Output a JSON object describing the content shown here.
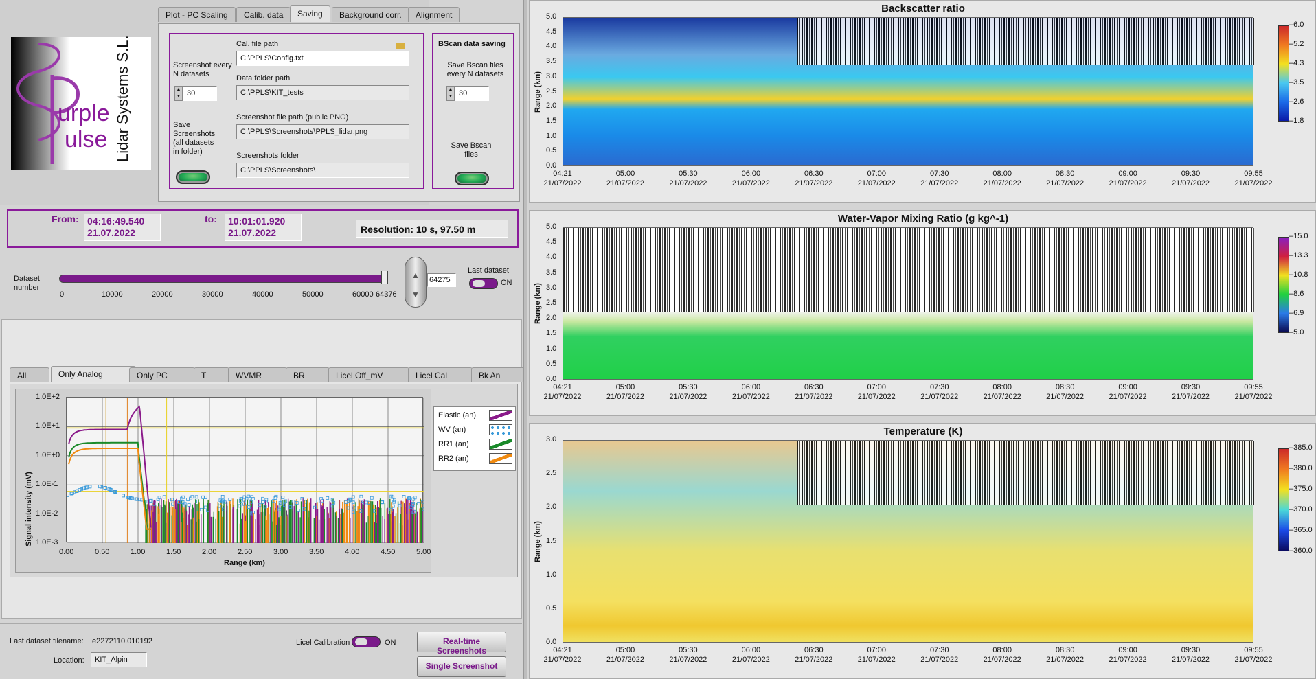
{
  "tabs_top": [
    "Plot - PC Scaling",
    "Calib. data",
    "Saving",
    "Background corr.",
    "Alignment"
  ],
  "logo": {
    "company": "Lidar Systems S.L.",
    "brand_line1": "urple",
    "brand_line2": "ulse"
  },
  "saving": {
    "screenshot_every_label": "Screenshot every N datasets",
    "screenshot_every_value": "30",
    "save_screenshots_label": "Save Screenshots (all datasets in folder)",
    "cal_file_label": "Cal. file path",
    "cal_file_value": "C:\\PPLS\\Config.txt",
    "data_folder_label": "Data folder path",
    "data_folder_value": "C:\\PPLS\\KIT_tests",
    "screenshot_path_label": "Screenshot file path (public PNG)",
    "screenshot_path_value": "C:\\PPLS\\Screenshots\\PPLS_lidar.png",
    "screenshots_folder_label": "Screenshots folder",
    "screenshots_folder_value": "C:\\PPLS\\Screenshots\\",
    "bscan_title": "BScan data saving",
    "bscan_every_label": "Save Bscan files every N datasets",
    "bscan_every_value": "30",
    "save_bscan_label": "Save Bscan files"
  },
  "range": {
    "from_label": "From:",
    "from_time": "04:16:49.540",
    "from_date": "21.07.2022",
    "to_label": "to:",
    "to_time": "10:01:01.920",
    "to_date": "21.07.2022",
    "resolution": "Resolution: 10 s, 97.50 m"
  },
  "dataset": {
    "label": "Dataset number",
    "value": "64275",
    "fraction": 0.9983,
    "ticks": [
      "0",
      "10000",
      "20000",
      "30000",
      "40000",
      "50000",
      "60000",
      "64376"
    ],
    "last_label": "Last dataset",
    "last_state": "ON"
  },
  "tabs_bottom": [
    "All",
    "Only Analog",
    "Only PC",
    "T",
    "WVMR",
    "BR",
    "Licel Off_mV",
    "Licel Cal",
    "Bk An"
  ],
  "signal_plot": {
    "ylabel": "Signal intensity (mV)",
    "xlabel": "Range (km)",
    "yticks": [
      "1.0E+2",
      "1.0E+1",
      "1.0E+0",
      "1.0E-1",
      "1.0E-2",
      "1.0E-3"
    ],
    "xticks": [
      "0.00",
      "0.50",
      "1.00",
      "1.50",
      "2.00",
      "2.50",
      "3.00",
      "3.50",
      "4.00",
      "4.50",
      "5.00"
    ],
    "legend": [
      {
        "name": "Elastic (an)",
        "color": "#8a1a8a"
      },
      {
        "name": "WV (an)",
        "color": "#3a9ad9"
      },
      {
        "name": "RR1 (an)",
        "color": "#1a8a2a"
      },
      {
        "name": "RR2 (an)",
        "color": "#f08a10"
      }
    ]
  },
  "footer": {
    "last_file_label": "Last dataset filename:",
    "last_file_value": "e2272110.010192",
    "location_label": "Location:",
    "location_value": "KIT_Alpin",
    "licel_cal_label": "Licel Calibration",
    "licel_cal_state": "ON",
    "btn_realtime": "Real-time Screenshots",
    "btn_single": "Single Screenshot"
  },
  "plots": [
    {
      "title": "Backscatter ratio",
      "ylabel": "Range (km)",
      "yticks": [
        "5.0",
        "4.5",
        "4.0",
        "3.5",
        "3.0",
        "2.5",
        "2.0",
        "1.5",
        "1.0",
        "0.5",
        "0.0"
      ],
      "cbar": [
        "6.0",
        "5.2",
        "4.3",
        "3.5",
        "2.6",
        "1.8"
      ]
    },
    {
      "title": "Water-Vapor Mixing Ratio  (g kg^-1)",
      "ylabel": "Range (km)",
      "yticks": [
        "5.0",
        "4.5",
        "4.0",
        "3.5",
        "3.0",
        "2.5",
        "2.0",
        "1.5",
        "1.0",
        "0.5",
        "0.0"
      ],
      "cbar": [
        "15.0",
        "13.3",
        "10.8",
        "8.6",
        "6.9",
        "5.0"
      ]
    },
    {
      "title": "Temperature (K)",
      "ylabel": "Range (km)",
      "yticks": [
        "3.0",
        "2.5",
        "2.0",
        "1.5",
        "1.0",
        "0.5",
        "0.0"
      ],
      "cbar": [
        "385.0",
        "380.0",
        "375.0",
        "370.0",
        "365.0",
        "360.0"
      ]
    }
  ],
  "time_ticks": [
    "04:21",
    "05:00",
    "05:30",
    "06:00",
    "06:30",
    "07:00",
    "07:30",
    "08:00",
    "08:30",
    "09:00",
    "09:30",
    "09:55"
  ],
  "time_date": "21/07/2022",
  "colors": {
    "accent": "#8a1a9a"
  }
}
